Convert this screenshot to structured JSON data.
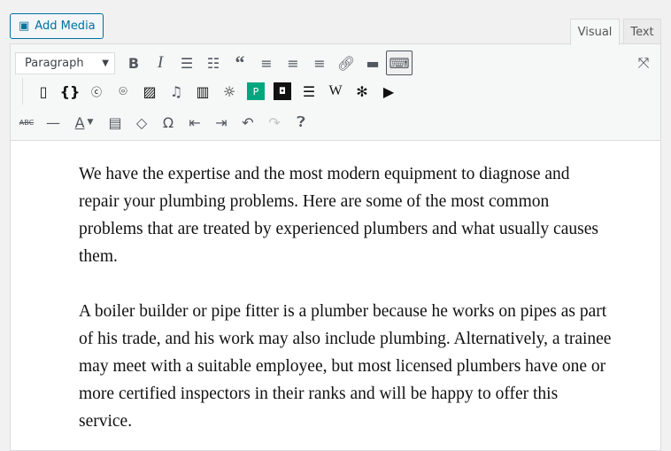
{
  "add_media": {
    "label": "Add Media",
    "icon": "media-icon"
  },
  "tabs": [
    {
      "label": "Visual",
      "active": true
    },
    {
      "label": "Text",
      "active": false
    }
  ],
  "toolbar": {
    "format_select": "Paragraph"
  },
  "content": {
    "paragraphs": [
      "We have the expertise and the most modern equipment to diagnose and repair your plumbing problems. Here are some of the most common problems that are treated by experienced plumbers and what usually causes them.",
      "A boiler builder or pipe fitter is a plumber because he works on pipes as part of his trade, and his work may also include plumbing. Alternatively, a trainee may meet with a suitable employee, but most licensed plumbers have one or more certified inspectors in their ranks and will be happy to offer this service."
    ]
  },
  "colors": {
    "accent": "#0071a1",
    "green_button": "#00a67e"
  }
}
